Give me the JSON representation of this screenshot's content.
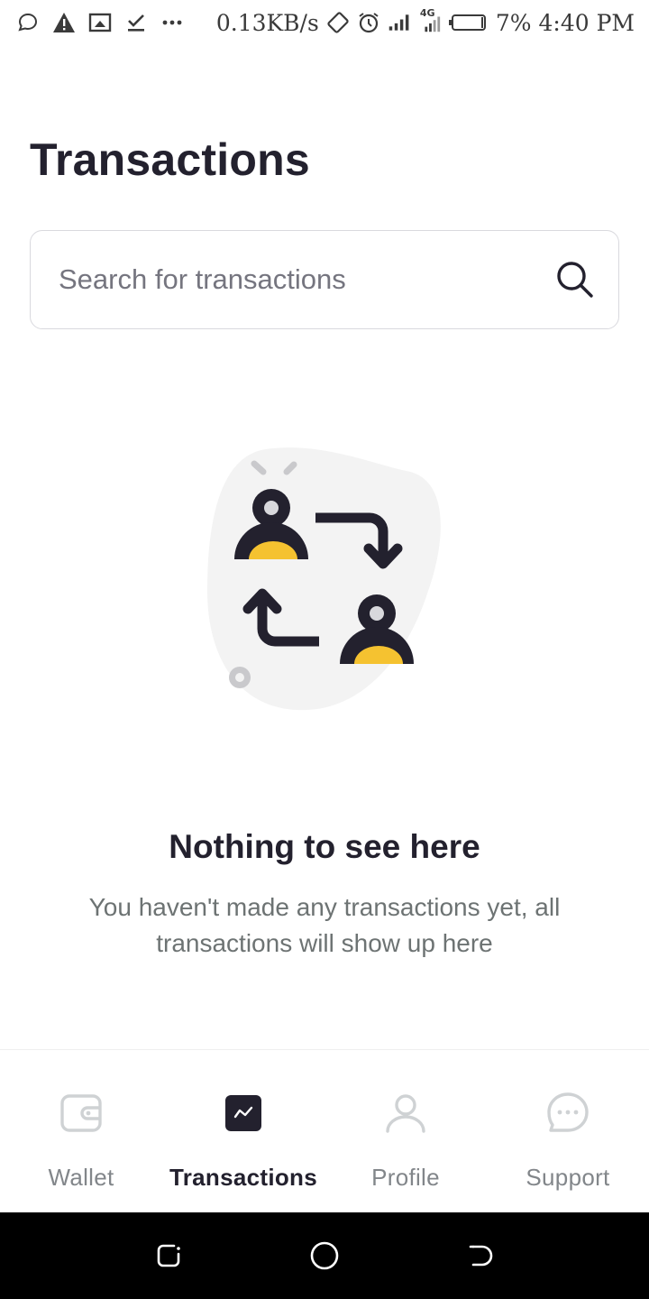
{
  "status_bar": {
    "net_speed": "0.13KB/s",
    "net_type": "4G",
    "battery": "7%",
    "time": "4:40 PM"
  },
  "page": {
    "title": "Transactions"
  },
  "search": {
    "placeholder": "Search for transactions",
    "value": ""
  },
  "empty_state": {
    "title": "Nothing to see here",
    "description": "You haven't made any transactions yet, all transactions will show up here"
  },
  "bottom_nav": {
    "active": "Transactions",
    "items": [
      {
        "label": "Wallet",
        "icon": "wallet-icon"
      },
      {
        "label": "Transactions",
        "icon": "transactions-chart-icon"
      },
      {
        "label": "Profile",
        "icon": "profile-icon"
      },
      {
        "label": "Support",
        "icon": "support-chat-icon"
      }
    ]
  },
  "colors": {
    "text_primary": "#23212e",
    "text_muted": "#6d7373",
    "accent_yellow": "#f5c230",
    "blob_gray": "#f3f3f3"
  }
}
